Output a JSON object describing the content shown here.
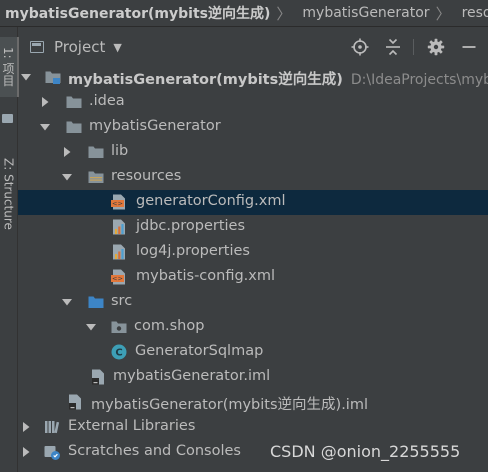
{
  "breadcrumb": [
    "mybatisGenerator(mybits逆向生成)",
    "mybatisGenerator",
    "resources"
  ],
  "sidebar": {
    "project_tab": "1: 项目",
    "structure_tab": "Z: Structure"
  },
  "panel": {
    "title": "Project",
    "tools": [
      "crosshair-icon",
      "collapse-icon",
      "gear-icon",
      "minimize-icon"
    ]
  },
  "tree": [
    {
      "label": "mybatisGenerator(mybits逆向生成)",
      "path": "D:\\IdeaProjects\\myb",
      "icon": "module-folder-icon",
      "arrow": "down",
      "bold": true
    },
    {
      "label": ".idea",
      "icon": "folder-icon",
      "arrow": "right"
    },
    {
      "label": "mybatisGenerator",
      "icon": "folder-icon",
      "arrow": "down"
    },
    {
      "label": "lib",
      "icon": "folder-icon",
      "arrow": "right"
    },
    {
      "label": "resources",
      "icon": "resources-folder-icon",
      "arrow": "down"
    },
    {
      "label": "generatorConfig.xml",
      "icon": "xml-file-icon",
      "selected": true
    },
    {
      "label": "jdbc.properties",
      "icon": "properties-file-icon"
    },
    {
      "label": "log4j.properties",
      "icon": "properties-file-icon"
    },
    {
      "label": "mybatis-config.xml",
      "icon": "xml-file-icon"
    },
    {
      "label": "src",
      "icon": "source-folder-icon",
      "arrow": "down"
    },
    {
      "label": "com.shop",
      "icon": "package-icon",
      "arrow": "down"
    },
    {
      "label": "GeneratorSqlmap",
      "icon": "java-class-icon"
    },
    {
      "label": "mybatisGenerator.iml",
      "icon": "iml-file-icon"
    },
    {
      "label": "mybatisGenerator(mybits逆向生成).iml",
      "icon": "iml-file-icon"
    },
    {
      "label": "External Libraries",
      "icon": "libraries-icon",
      "arrow": "right"
    },
    {
      "label": "Scratches and Consoles",
      "icon": "scratches-icon",
      "arrow": "right"
    }
  ],
  "watermark": "CSDN @onion_2255555",
  "colors": {
    "background": "#3c3f41",
    "selection": "#0d293e",
    "text": "#bbbbbb",
    "folder": "#87939a",
    "source_folder": "#3d85c6",
    "xml": "#e2773a",
    "java_class": "#3d9fb6"
  }
}
